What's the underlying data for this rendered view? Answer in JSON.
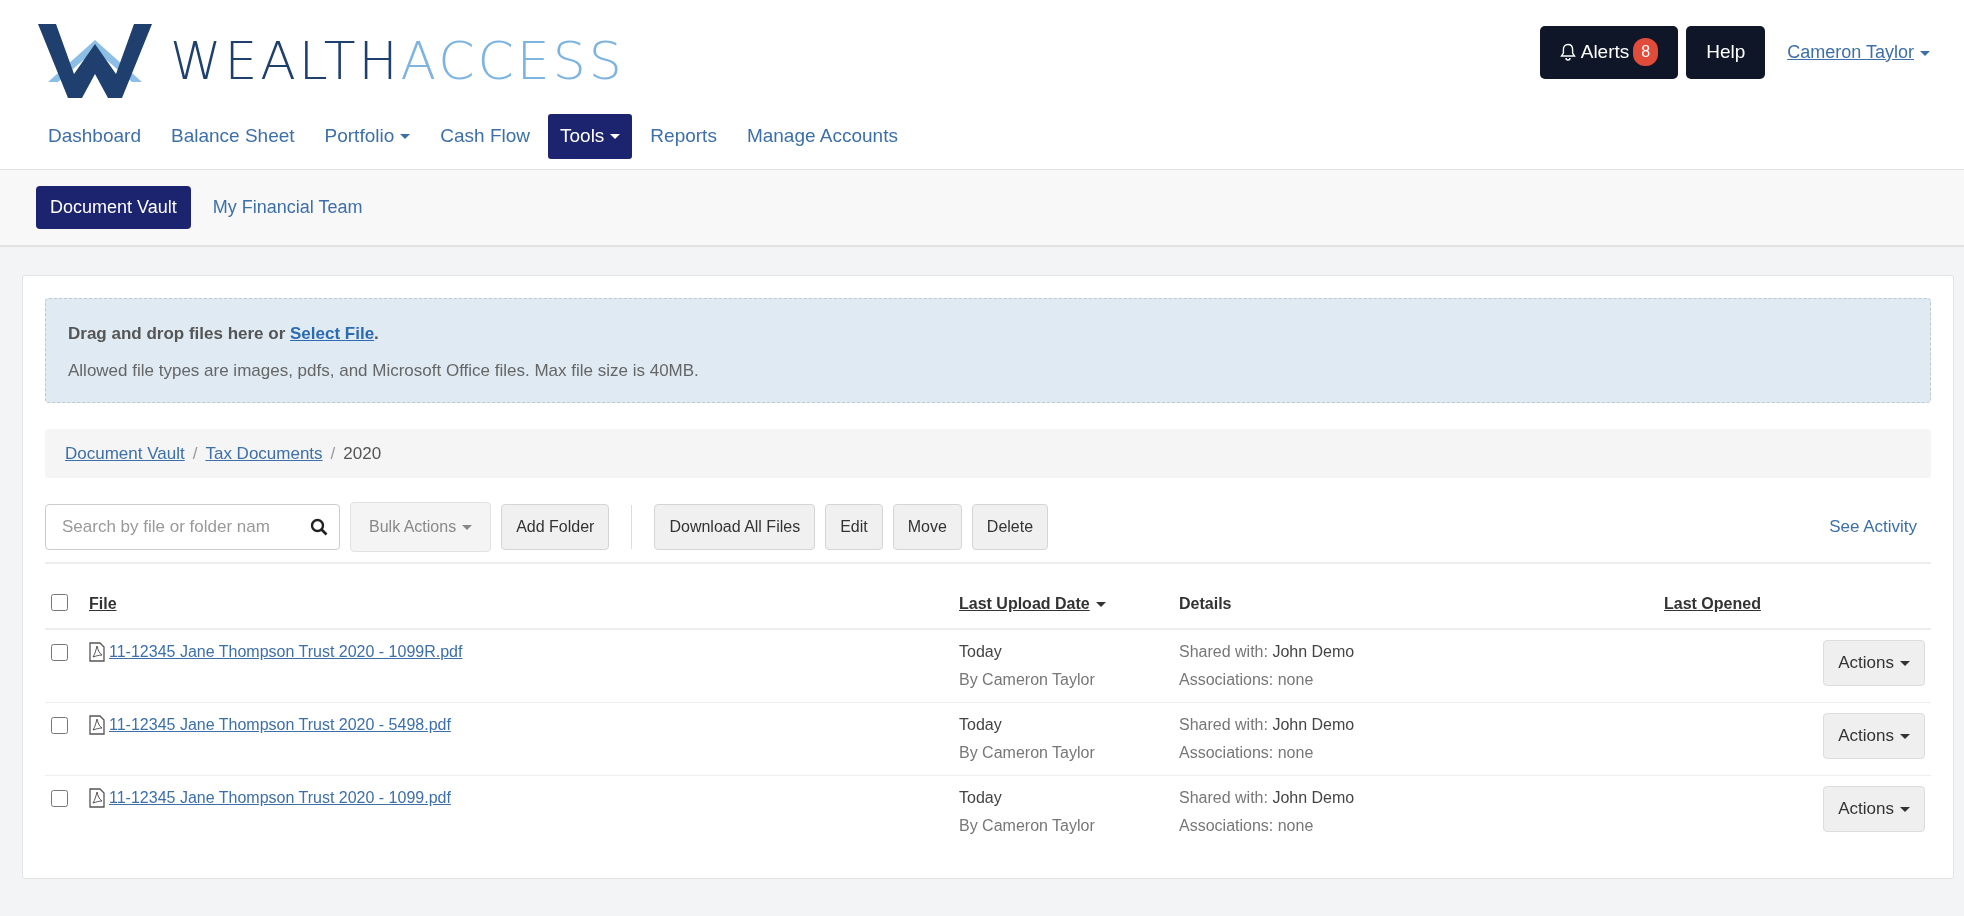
{
  "logo": {
    "dark_part": "WEALTH",
    "light_part": "ACCESS"
  },
  "header_buttons": {
    "alerts": {
      "label": "Alerts",
      "count": "8"
    },
    "help": {
      "label": "Help"
    },
    "user": {
      "label": "Cameron Taylor"
    }
  },
  "nav": [
    {
      "label": "Dashboard",
      "selected": false,
      "dropdown": false
    },
    {
      "label": "Balance Sheet",
      "selected": false,
      "dropdown": false
    },
    {
      "label": "Portfolio",
      "selected": false,
      "dropdown": true
    },
    {
      "label": "Cash Flow",
      "selected": false,
      "dropdown": false
    },
    {
      "label": "Tools",
      "selected": true,
      "dropdown": true
    },
    {
      "label": "Reports",
      "selected": false,
      "dropdown": false
    },
    {
      "label": "Manage Accounts",
      "selected": false,
      "dropdown": false
    }
  ],
  "subnav": [
    {
      "label": "Document Vault",
      "selected": true
    },
    {
      "label": "My Financial Team",
      "selected": false
    }
  ],
  "upload": {
    "text_before": "Drag and drop files here or ",
    "link": "Select File",
    "text_after": ".",
    "note": "Allowed file types are images, pdfs, and Microsoft Office files. Max file size is 40MB."
  },
  "breadcrumb": [
    {
      "label": "Document Vault",
      "link": true
    },
    {
      "separator_before": "/",
      "label": "Tax Documents",
      "link": true
    },
    {
      "separator_before": "/",
      "label": "2020",
      "link": false
    }
  ],
  "toolbar": {
    "search": {
      "placeholder": "Search by file or folder nam"
    },
    "button_groups": [
      [
        {
          "label": "Bulk Actions",
          "dropdown": true,
          "disabled": true
        },
        {
          "label": "Add Folder",
          "dropdown": false,
          "disabled": false
        }
      ],
      [
        {
          "label": "Download All Files",
          "dropdown": false,
          "disabled": false
        },
        {
          "label": "Edit",
          "dropdown": false,
          "disabled": false
        },
        {
          "label": "Move",
          "dropdown": false,
          "disabled": false
        },
        {
          "label": "Delete",
          "dropdown": false,
          "disabled": false
        }
      ]
    ],
    "see_activity": "See Activity"
  },
  "table": {
    "select_all_checked": false,
    "columns": [
      {
        "label": "File",
        "sortable": true,
        "sorted": false
      },
      {
        "label": "Last Upload Date",
        "sortable": true,
        "sorted": true
      },
      {
        "label": "Details",
        "sortable": false,
        "sorted": false
      },
      {
        "label": "Last Opened",
        "sortable": true,
        "sorted": false
      }
    ],
    "rows": [
      {
        "checked": false,
        "file": "11-12345 Jane Thompson Trust 2020 - 1099R.pdf",
        "date": "Today",
        "by": "By Cameron Taylor",
        "shared_label": "Shared with:",
        "shared_value": "John Demo",
        "associations": "Associations: none",
        "action": "Actions"
      },
      {
        "checked": false,
        "file": "11-12345 Jane Thompson Trust 2020 - 5498.pdf",
        "date": "Today",
        "by": "By Cameron Taylor",
        "shared_label": "Shared with:",
        "shared_value": "John Demo",
        "associations": "Associations: none",
        "action": "Actions"
      },
      {
        "checked": false,
        "file": "11-12345 Jane Thompson Trust 2020 - 1099.pdf",
        "date": "Today",
        "by": "By Cameron Taylor",
        "shared_label": "Shared with:",
        "shared_value": "John Demo",
        "associations": "Associations: none",
        "action": "Actions"
      }
    ]
  }
}
